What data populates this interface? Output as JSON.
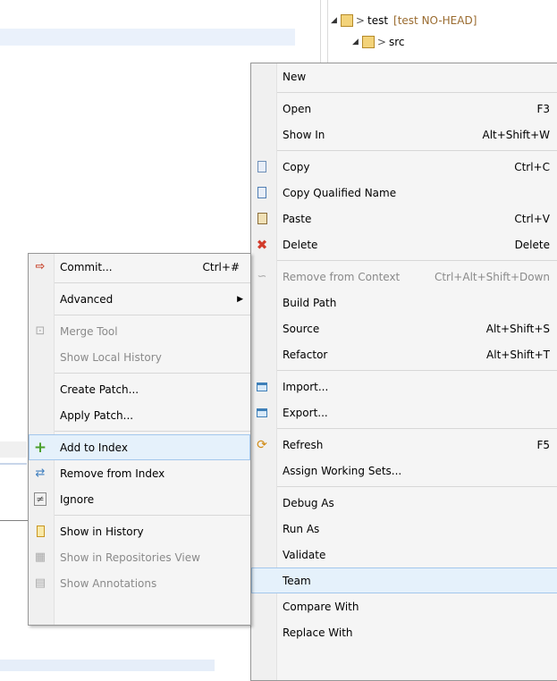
{
  "explorer": {
    "project": {
      "name": "test",
      "decoration": "[test NO-HEAD]"
    },
    "folder": {
      "name": "src"
    }
  },
  "context_menu": {
    "items": [
      {
        "label": "New",
        "shortcut": "",
        "icon": "",
        "submenu": true
      },
      {
        "sep": true
      },
      {
        "label": "Open",
        "shortcut": "F3",
        "icon": ""
      },
      {
        "label": "Show In",
        "shortcut": "Alt+Shift+W",
        "icon": "",
        "submenu": true
      },
      {
        "sep": true
      },
      {
        "label": "Copy",
        "shortcut": "Ctrl+C",
        "icon": "copy-icon"
      },
      {
        "label": "Copy Qualified Name",
        "shortcut": "",
        "icon": "copy-qualified-icon"
      },
      {
        "label": "Paste",
        "shortcut": "Ctrl+V",
        "icon": "paste-icon"
      },
      {
        "label": "Delete",
        "shortcut": "Delete",
        "icon": "delete-icon"
      },
      {
        "sep": true
      },
      {
        "label": "Remove from Context",
        "shortcut": "Ctrl+Alt+Shift+Down",
        "icon": "remove-context-icon",
        "disabled": true
      },
      {
        "label": "Build Path",
        "shortcut": "",
        "icon": "",
        "submenu": true
      },
      {
        "label": "Source",
        "shortcut": "Alt+Shift+S",
        "icon": "",
        "submenu": true
      },
      {
        "label": "Refactor",
        "shortcut": "Alt+Shift+T",
        "icon": "",
        "submenu": true
      },
      {
        "sep": true
      },
      {
        "label": "Import...",
        "shortcut": "",
        "icon": "import-icon"
      },
      {
        "label": "Export...",
        "shortcut": "",
        "icon": "export-icon"
      },
      {
        "sep": true
      },
      {
        "label": "Refresh",
        "shortcut": "F5",
        "icon": "refresh-icon"
      },
      {
        "label": "Assign Working Sets...",
        "shortcut": "",
        "icon": ""
      },
      {
        "sep": true
      },
      {
        "label": "Debug As",
        "shortcut": "",
        "icon": "",
        "submenu": true
      },
      {
        "label": "Run As",
        "shortcut": "",
        "icon": "",
        "submenu": true
      },
      {
        "label": "Validate",
        "shortcut": "",
        "icon": ""
      },
      {
        "label": "Team",
        "shortcut": "",
        "icon": "",
        "submenu": true,
        "highlighted": true
      },
      {
        "label": "Compare With",
        "shortcut": "",
        "icon": "",
        "submenu": true
      },
      {
        "label": "Replace With",
        "shortcut": "",
        "icon": "",
        "submenu": true
      }
    ]
  },
  "team_menu": {
    "items": [
      {
        "label": "Commit...",
        "shortcut": "Ctrl+#",
        "icon": "commit-icon"
      },
      {
        "sep": true
      },
      {
        "label": "Advanced",
        "shortcut": "",
        "icon": "",
        "submenu": true
      },
      {
        "sep": true
      },
      {
        "label": "Merge Tool",
        "shortcut": "",
        "icon": "merge-tool-icon",
        "disabled": true
      },
      {
        "label": "Show Local History",
        "shortcut": "",
        "icon": "",
        "disabled": true
      },
      {
        "sep": true
      },
      {
        "label": "Create Patch...",
        "shortcut": "",
        "icon": ""
      },
      {
        "label": "Apply Patch...",
        "shortcut": "",
        "icon": ""
      },
      {
        "sep": true
      },
      {
        "label": "Add to Index",
        "shortcut": "",
        "icon": "add-to-index-icon",
        "highlighted": true
      },
      {
        "label": "Remove from Index",
        "shortcut": "",
        "icon": "remove-from-index-icon"
      },
      {
        "label": "Ignore",
        "shortcut": "",
        "icon": "ignore-icon"
      },
      {
        "sep": true
      },
      {
        "label": "Show in History",
        "shortcut": "",
        "icon": "show-history-icon"
      },
      {
        "label": "Show in Repositories View",
        "shortcut": "",
        "icon": "repositories-view-icon",
        "disabled": true
      },
      {
        "label": "Show Annotations",
        "shortcut": "",
        "icon": "annotations-icon",
        "disabled": true
      }
    ]
  },
  "colors": {
    "menu_bg": "#f5f5f5",
    "highlight_bg": "#e5f1fb",
    "highlight_border": "#a3c7ec",
    "disabled_text": "#8a8a8a"
  }
}
